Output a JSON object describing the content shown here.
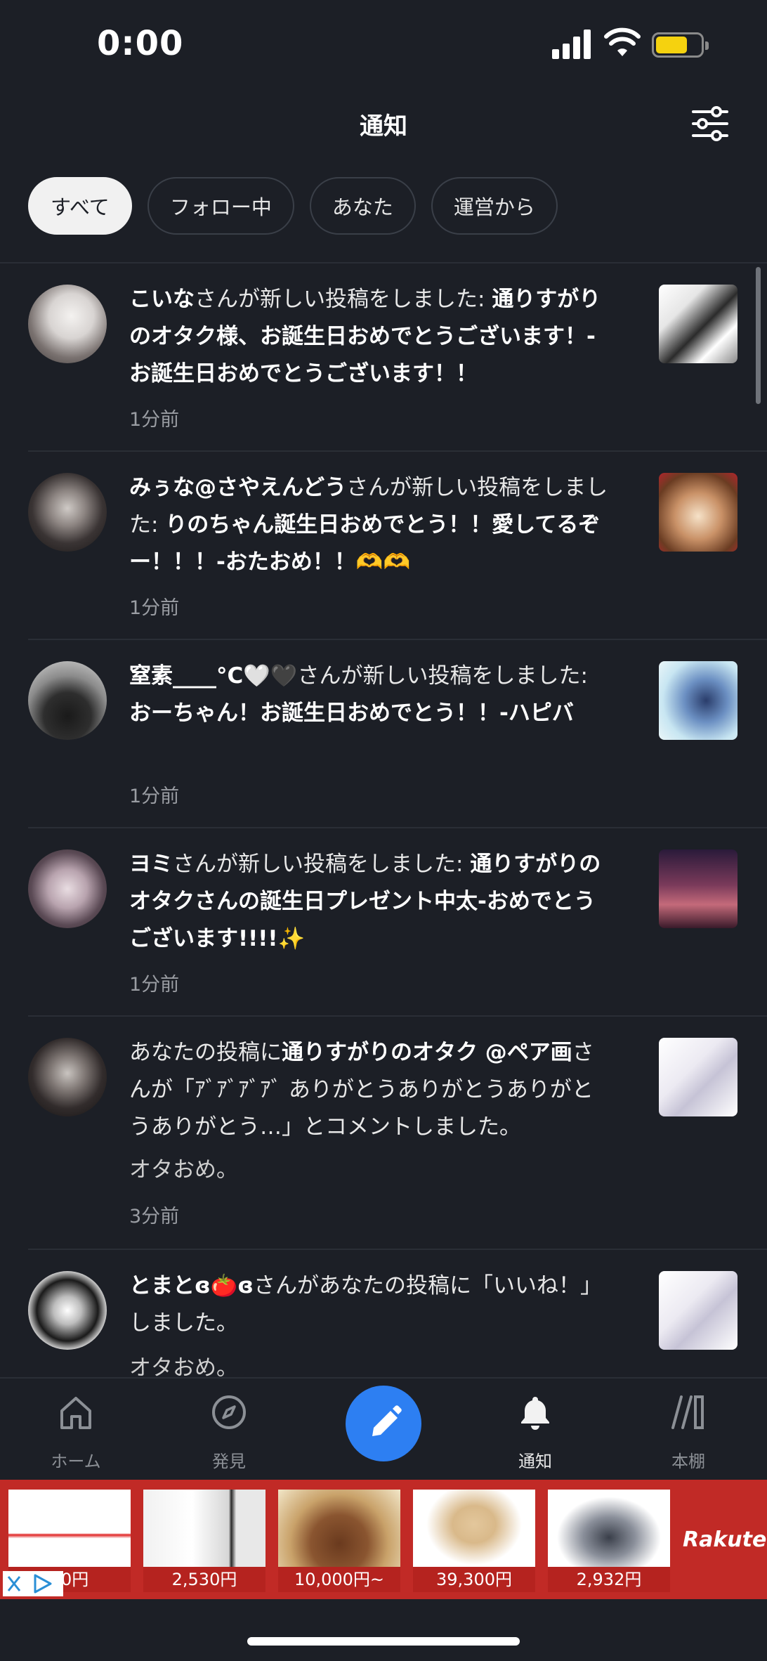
{
  "status": {
    "time": "0:00"
  },
  "header": {
    "title": "通知"
  },
  "tabs": [
    {
      "label": "すべて",
      "active": true
    },
    {
      "label": "フォロー中",
      "active": false
    },
    {
      "label": "あなた",
      "active": false
    },
    {
      "label": "運営から",
      "active": false
    }
  ],
  "notifications": [
    {
      "user": "こいな",
      "action": "さんが新しい投稿をしました: ",
      "content": "通りすがりのオタク様、お誕生日おめでとうございます！-お誕生日おめでとうございます！！",
      "time": "1分前"
    },
    {
      "user": "みぅな@さやえんどう",
      "action": "さんが新しい投稿をしました: ",
      "content": "りのちゃん誕生日おめでとう！！愛してるぞー！！！-おたおめ！！🫶🫶",
      "time": "1分前"
    },
    {
      "user": "窒素____°C🤍🖤",
      "action": "さんが新しい投稿をしました: ",
      "content": "おーちゃん！お誕生日おめでとう！！-ハピバ",
      "time": "1分前"
    },
    {
      "user": "ヨミ",
      "action": "さんが新しい投稿をしました: ",
      "content": "通りすがりのオタクさんの誕生日プレゼント中太-おめでとうございます!!!!✨",
      "time": "1分前"
    },
    {
      "prefix": "あなたの投稿に",
      "user": "通りすがりのオタク @ペア画",
      "action": "さんが「ｱﾞｱﾞｱﾞｱﾞ ありがとうありがとうありがとうありがとう…」とコメントしました。",
      "extra": "オタおめ。",
      "time": "3分前"
    },
    {
      "user": "とまとɞ🍅ɞ",
      "action": "さんがあなたの投稿に「いいね！」しました。",
      "extra": "オタおめ。"
    }
  ],
  "nav": [
    {
      "label": "ホーム",
      "icon": "home-icon"
    },
    {
      "label": "発見",
      "icon": "compass-icon"
    },
    {
      "label": "通知",
      "icon": "bell-icon",
      "active": true
    },
    {
      "label": "本棚",
      "icon": "bookshelf-icon"
    }
  ],
  "ad": {
    "brand": "Rakuten",
    "prices": [
      "60円",
      "2,530円",
      "10,000円~",
      "39,300円",
      "2,932円"
    ]
  }
}
